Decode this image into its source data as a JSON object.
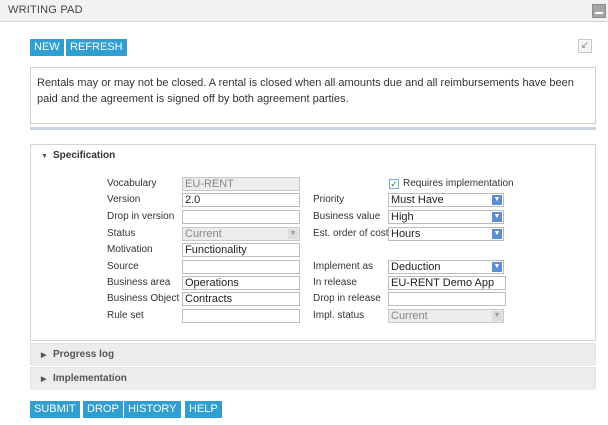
{
  "window": {
    "title": "WRITING PAD"
  },
  "toolbar": {
    "new_label": "NEW",
    "refresh_label": "REFRESH"
  },
  "description": "Rentals may or may not be closed. A rental is closed when all amounts due and all reimbursements have been paid and the agreement is signed off by both agreement parties.",
  "specification": {
    "header": "Specification",
    "left": [
      {
        "label": "Vocabulary",
        "value": "EU-RENT"
      },
      {
        "label": "Version",
        "value": "2.0"
      },
      {
        "label": "Drop in version",
        "value": ""
      },
      {
        "label": "Status",
        "value": "Current"
      },
      {
        "label": "Motivation",
        "value": "Functionality"
      },
      {
        "label": "Source",
        "value": ""
      },
      {
        "label": "Business area",
        "value": "Operations"
      },
      {
        "label": "Business Object",
        "value": "Contracts"
      },
      {
        "label": "Rule set",
        "value": ""
      }
    ],
    "requires_implementation": {
      "label": "Requires implementation",
      "checked": true
    },
    "right": [
      {
        "label": "Priority",
        "value": "Must Have"
      },
      {
        "label": "Business value",
        "value": "High"
      },
      {
        "label": "Est. order of cost",
        "value": "Hours"
      },
      {
        "label": "Implement as",
        "value": "Deduction"
      },
      {
        "label": "In release",
        "value": "EU-RENT Demo App"
      },
      {
        "label": "Drop in release",
        "value": ""
      },
      {
        "label": "Impl. status",
        "value": "Current"
      }
    ]
  },
  "sections": {
    "progress_log": "Progress log",
    "implementation": "Implementation"
  },
  "footer": {
    "submit": "SUBMIT",
    "drop": "DROP",
    "history": "HISTORY",
    "help": "HELP"
  },
  "colors": {
    "button": "#2e9fd0",
    "select_arrow": "#5b8ed6"
  }
}
